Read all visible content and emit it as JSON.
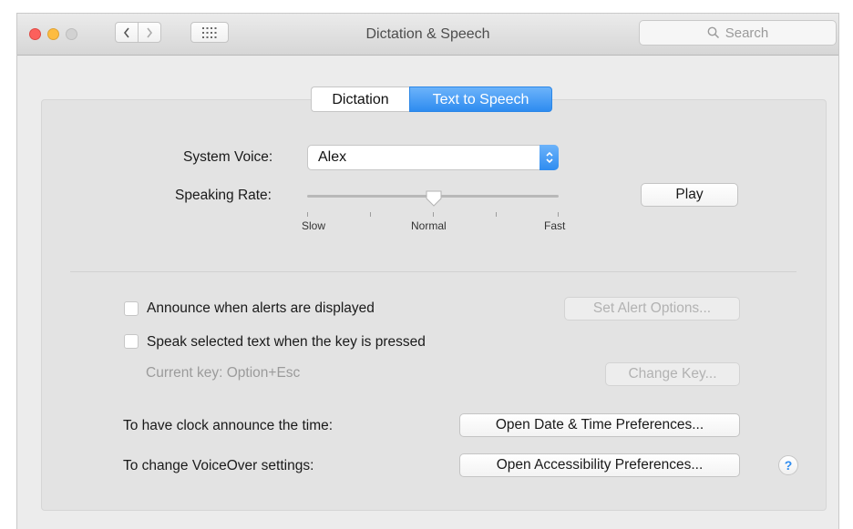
{
  "window": {
    "title": "Dictation & Speech",
    "search_placeholder": "Search"
  },
  "tabs": [
    {
      "label": "Dictation",
      "selected": false
    },
    {
      "label": "Text to Speech",
      "selected": true
    }
  ],
  "voice": {
    "label": "System Voice:",
    "value": "Alex"
  },
  "rate": {
    "label": "Speaking Rate:",
    "min_label": "Slow",
    "mid_label": "Normal",
    "max_label": "Fast",
    "level": 0.5,
    "play_label": "Play"
  },
  "alerts": {
    "checkbox_label": "Announce when alerts are displayed",
    "checked": false,
    "options_button": "Set Alert Options..."
  },
  "speak_selected": {
    "checkbox_label": "Speak selected text when the key is pressed",
    "checked": false,
    "current_key": "Current key: Option+Esc",
    "change_button": "Change Key..."
  },
  "clock": {
    "label": "To have clock announce the time:",
    "button": "Open Date & Time Preferences..."
  },
  "voiceover": {
    "label": "To change VoiceOver settings:",
    "button": "Open Accessibility Preferences..."
  },
  "help_label": "?",
  "colors": {
    "accent": "#2e8cf0",
    "close": "#fc605c",
    "minimize": "#fdbc40",
    "zoom_disabled": "#d2d2d2"
  }
}
